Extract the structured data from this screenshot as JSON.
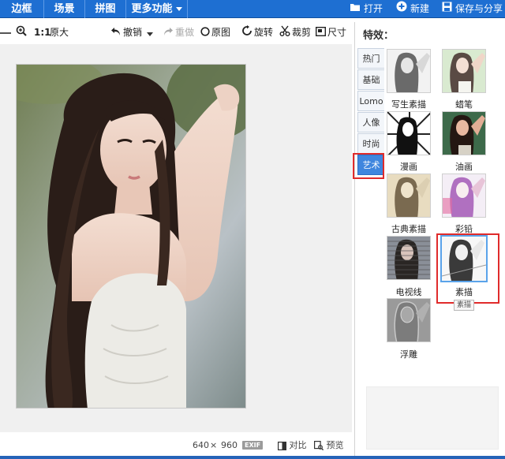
{
  "topbar": {
    "tabs": [
      "边框",
      "场景",
      "拼图",
      "更多功能"
    ],
    "open_label": "打开",
    "new_label": "新建",
    "save_share_label": "保存与分享"
  },
  "toolbar": {
    "ratio_label": "1:1",
    "original_size_label": "原大",
    "undo_label": "撤销",
    "redo_label": "重做",
    "original_label": "原图",
    "rotate_label": "旋转",
    "crop_label": "裁剪",
    "size_label": "尺寸"
  },
  "statusbar": {
    "width": "640",
    "times": "×",
    "height": "960",
    "exif_label": "EXIF",
    "compare_label": "对比",
    "preview_label": "预览"
  },
  "panel": {
    "title": "特效：",
    "categories": [
      "热门",
      "基础",
      "Lomo",
      "人像",
      "时尚",
      "艺术"
    ],
    "active_category": "艺术",
    "effects": [
      "写生素描",
      "蜡笔",
      "漫画",
      "油画",
      "古典素描",
      "彩铅",
      "电视线",
      "素描",
      "浮雕"
    ],
    "selected_effect": "素描",
    "tooltip": "素描"
  },
  "colors": {
    "topbar": "#1e6fd2",
    "active_category": "#3f86de",
    "highlight": "#e02b2b"
  }
}
